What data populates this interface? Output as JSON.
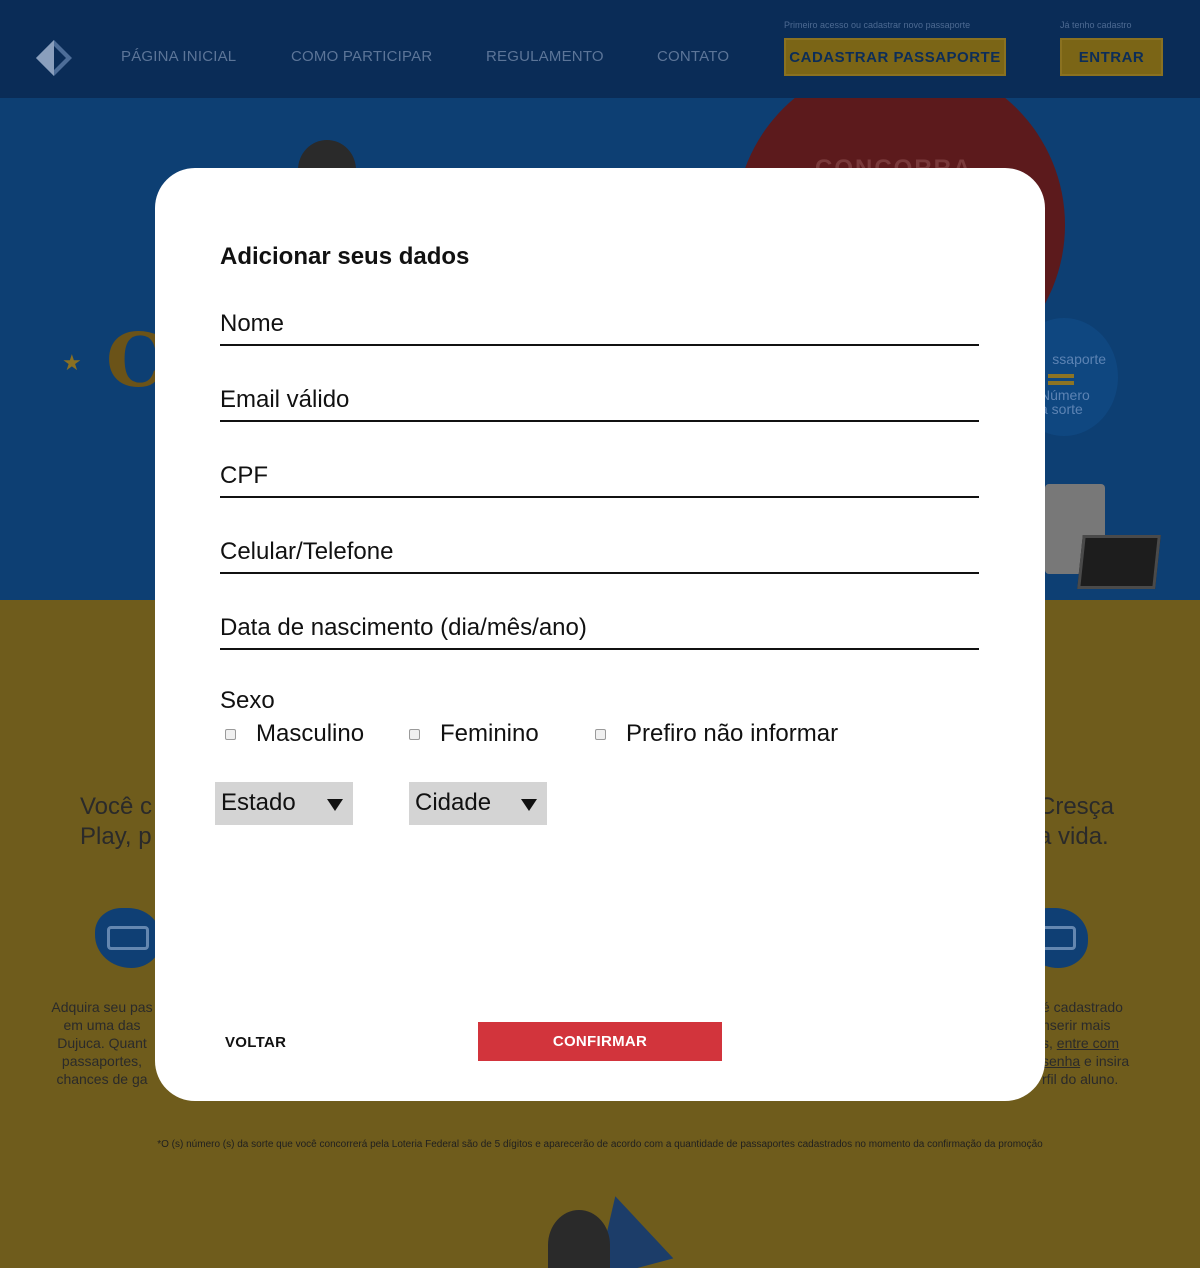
{
  "header": {
    "nav": [
      "PÁGINA INICIAL",
      "COMO PARTICIPAR",
      "REGULAMENTO",
      "CONTATO"
    ],
    "register_hint": "Primeiro acesso ou cadastrar novo passaporte",
    "register_button": "CADASTRAR PASSAPORTE",
    "login_hint": "Já tenho cadastro",
    "login_button": "ENTRAR"
  },
  "background": {
    "hero_heading": "CONCORRA A",
    "badge_line1": "ssaporte",
    "badge_line2": "Número",
    "badge_line3": "a sorte",
    "big_letter": "C",
    "text_left_1": "Você c",
    "text_left_2": "Play, p",
    "text_right_1": "Cresça",
    "text_right_2": "a vida.",
    "small_left": [
      "Adquira seu pas",
      "em uma das",
      "Dujuca. Quant",
      "passaportes,",
      "chances de ga"
    ],
    "small_right_1": "é cadastrado",
    "small_right_2": "nserir mais",
    "small_right_3": "s, ",
    "small_right_link1": "entre com",
    "small_right_link2": "senha",
    "small_right_4": " e insira",
    "small_right_5": "rfil do aluno.",
    "footnote": "*O (s) número (s) da sorte que você concorrerá pela Loteria Federal são de 5 dígitos e aparecerão de acordo com a quantidade de passaportes cadastrados no momento da confirmação da promoção"
  },
  "modal": {
    "title": "Adicionar seus dados",
    "fields": {
      "nome": "Nome",
      "email": "Email válido",
      "cpf": "CPF",
      "telefone": "Celular/Telefone",
      "nascimento": "Data de nascimento (dia/mês/ano)"
    },
    "sexo_label": "Sexo",
    "sexo_options": [
      "Masculino",
      "Feminino",
      "Prefiro não informar"
    ],
    "estado": "Estado",
    "cidade": "Cidade",
    "back_button": "VOLTAR",
    "confirm_button": "CONFIRMAR"
  },
  "colors": {
    "header_bg": "#0a2c57",
    "accent_yellow": "#7b6516",
    "confirm_red": "#d2343c"
  }
}
